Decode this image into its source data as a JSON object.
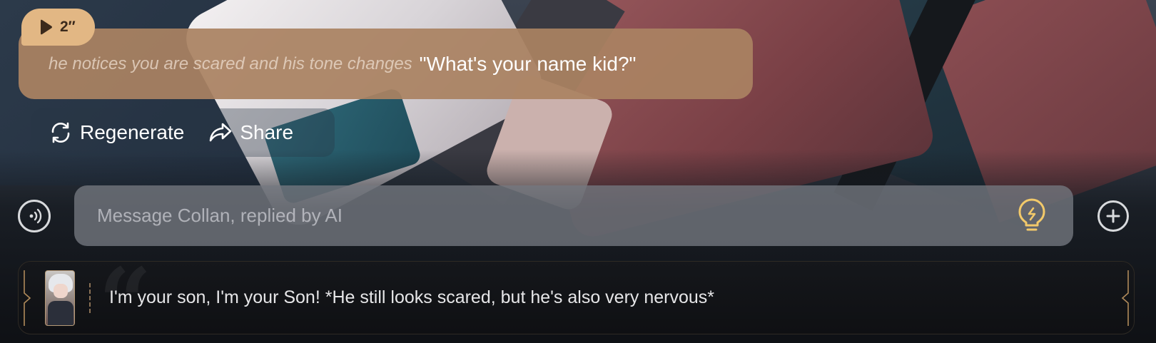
{
  "message": {
    "audio_duration": "2″",
    "action_text": "he notices you are scared and his tone changes",
    "dialogue": "\"What's your name kid?\""
  },
  "actions": {
    "regenerate_label": "Regenerate",
    "share_label": "Share"
  },
  "composer": {
    "placeholder": "Message Collan, replied by AI"
  },
  "suggestion": {
    "text": "I'm your son, I'm your Son! *He still looks scared, but he's also very nervous*"
  },
  "colors": {
    "bubble": "#aa8262",
    "audio_tag": "#e2b784",
    "bulb": "#f2c96a"
  }
}
